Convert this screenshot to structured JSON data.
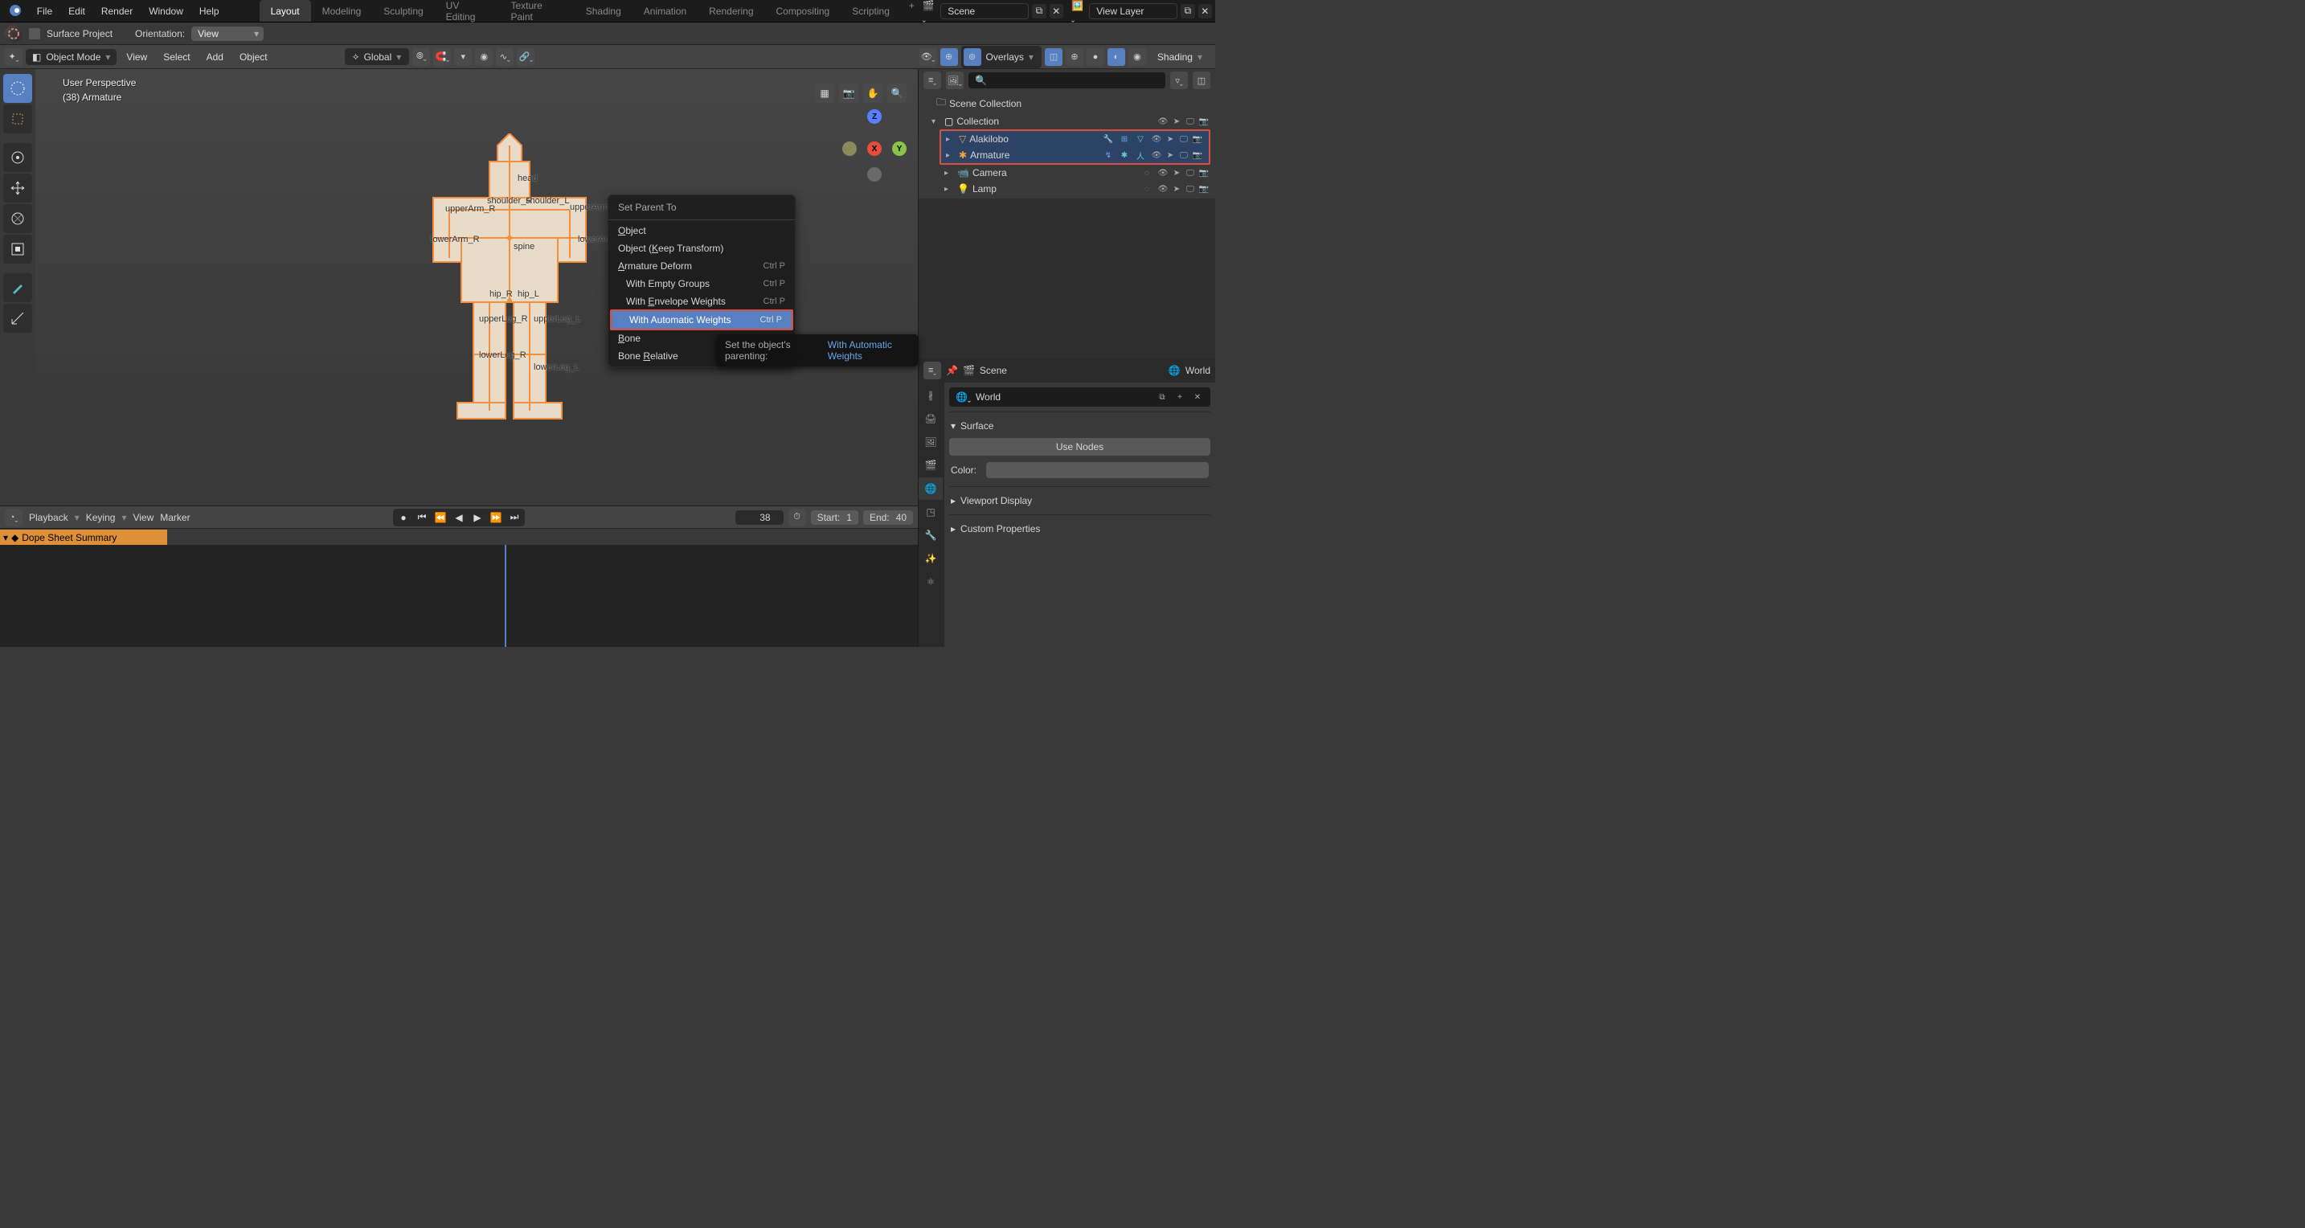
{
  "topmenu": {
    "items": [
      "File",
      "Edit",
      "Render",
      "Window",
      "Help"
    ],
    "tabs": [
      "Layout",
      "Modeling",
      "Sculpting",
      "UV Editing",
      "Texture Paint",
      "Shading",
      "Animation",
      "Rendering",
      "Compositing",
      "Scripting"
    ],
    "active_tab": 0,
    "scene": "Scene",
    "view_layer": "View Layer"
  },
  "header": {
    "surface_project": "Surface Project",
    "orientation": "Orientation:",
    "view": "View"
  },
  "subheader": {
    "mode": "Object Mode",
    "menus": [
      "View",
      "Select",
      "Add",
      "Object"
    ],
    "global": "Global",
    "overlays": "Overlays",
    "shading": "Shading"
  },
  "viewport": {
    "perspective": "User Perspective",
    "object": "(38) Armature",
    "bones": [
      "head",
      "shoulder_R",
      "shoulder_L",
      "upperArm_R",
      "upperArm_L",
      "lowerArm_R",
      "lowerArm_L",
      "spine",
      "hip_R",
      "hip_L",
      "upperLeg_R",
      "upperLeg_L",
      "lowerLeg_R",
      "lowerLeg_L"
    ],
    "axes": {
      "z": "Z",
      "y": "Y",
      "x": "X"
    }
  },
  "context": {
    "title": "Set Parent To",
    "items": [
      {
        "label": "Object",
        "underline": "O",
        "sc": "",
        "indent": false,
        "hl": false
      },
      {
        "label": "Object (Keep Transform)",
        "underline": "K",
        "sc": "",
        "indent": false,
        "hl": false
      },
      {
        "label": "Armature Deform",
        "underline": "A",
        "sc": "Ctrl P",
        "indent": false,
        "hl": false
      },
      {
        "label": "   With Empty Groups",
        "underline": "",
        "sc": "Ctrl P",
        "indent": true,
        "hl": false
      },
      {
        "label": "   With Envelope Weights",
        "underline": "E",
        "sc": "Ctrl P",
        "indent": true,
        "hl": false
      },
      {
        "label": "   With Automatic Weights",
        "underline": "",
        "sc": "Ctrl P",
        "indent": true,
        "hl": true
      },
      {
        "label": "Bone",
        "underline": "B",
        "sc": "",
        "indent": false,
        "hl": false
      },
      {
        "label": "Bone Relative",
        "underline": "R",
        "sc": "",
        "indent": false,
        "hl": false
      }
    ]
  },
  "tooltip": {
    "lbl": "Set the object's parenting:",
    "val": "With Automatic Weights"
  },
  "outliner": {
    "root": "Scene Collection",
    "collection": "Collection",
    "items": [
      {
        "name": "Alakilobo",
        "icon": "mesh",
        "sel": true
      },
      {
        "name": "Armature",
        "icon": "armature",
        "sel": true
      },
      {
        "name": "Camera",
        "icon": "camera",
        "sel": false
      },
      {
        "name": "Lamp",
        "icon": "light",
        "sel": false
      }
    ]
  },
  "properties": {
    "scene": "Scene",
    "world": "World",
    "world_field": "World",
    "surface": "Surface",
    "use_nodes": "Use Nodes",
    "color_label": "Color:",
    "viewport_display": "Viewport Display",
    "custom_props": "Custom Properties"
  },
  "timeline": {
    "playback": "Playback",
    "keying": "Keying",
    "view": "View",
    "marker": "Marker",
    "frame": "38",
    "start_label": "Start:",
    "start": "1",
    "end_label": "End:",
    "end": "40",
    "dope": "Dope Sheet Summary"
  }
}
